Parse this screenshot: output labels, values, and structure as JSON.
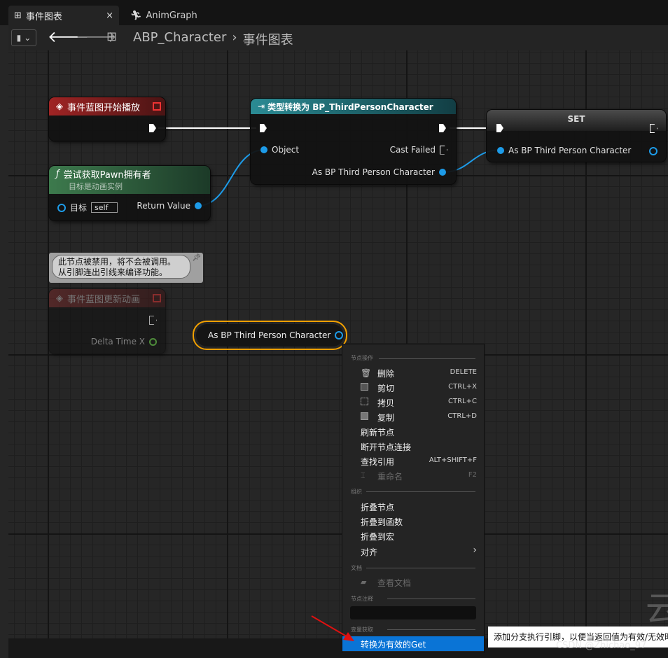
{
  "tabs": [
    {
      "label": "事件图表",
      "icon": "event-graph-icon",
      "active": true,
      "close": "×"
    },
    {
      "label": "AnimGraph",
      "icon": "anim-graph-icon",
      "active": false
    }
  ],
  "breadcrumb": {
    "blueprint": "ABP_Character",
    "separator": "›",
    "graph": "事件图表"
  },
  "nodes": {
    "begin_play": {
      "title": "事件蓝图开始播放"
    },
    "try_get_pawn": {
      "title": "尝试获取Pawn拥有者",
      "subtitle": "目标是动画实例",
      "target_label": "目标",
      "target_value": "self",
      "return_label": "Return Value",
      "function_glyph": "ƒ"
    },
    "cast": {
      "title": "类型转换为 BP_ThirdPersonCharacter",
      "object_label": "Object",
      "cast_failed_label": "Cast Failed",
      "output_label": "As BP Third Person Character"
    },
    "set": {
      "title": "SET",
      "input_label": "As BP Third Person Character"
    },
    "disabled_comment": {
      "line1": "此节点被禁用，将不会被调用。",
      "line2": "从引脚连出引线来编译功能。"
    },
    "update_anim": {
      "title": "事件蓝图更新动画",
      "delta_label": "Delta Time X"
    },
    "get_var": {
      "label": "As BP Third Person Character"
    }
  },
  "context_menu": {
    "sections": {
      "node_actions": "节点操作",
      "organize": "组织",
      "docs": "文档",
      "node_comment": "节点注释",
      "variable_get": "变量获取"
    },
    "node_actions": [
      {
        "label": "删除",
        "shortcut": "DELETE",
        "icon": "trash-icon"
      },
      {
        "label": "剪切",
        "shortcut": "CTRL+X",
        "icon": "cut-icon"
      },
      {
        "label": "拷贝",
        "shortcut": "CTRL+C",
        "icon": "copy-icon"
      },
      {
        "label": "复制",
        "shortcut": "CTRL+D",
        "icon": "duplicate-icon"
      },
      {
        "label": "刷新节点",
        "shortcut": ""
      },
      {
        "label": "断开节点连接",
        "shortcut": ""
      },
      {
        "label": "查找引用",
        "shortcut": "ALT+SHIFT+F"
      },
      {
        "label": "重命名",
        "shortcut": "F2",
        "icon": "rename-icon",
        "disabled": true
      }
    ],
    "organize": [
      {
        "label": "折叠节点"
      },
      {
        "label": "折叠到函数"
      },
      {
        "label": "折叠到宏"
      },
      {
        "label": "对齐",
        "submenu": "›"
      }
    ],
    "docs_item": "查看文档",
    "variable_item": "转换为有效的Get"
  },
  "tooltip": "添加分支执行引脚，以便当返回值为有效/无效时",
  "watermark": "CSDN @Zhichao_97",
  "watermark_big": "云",
  "colors": {
    "accent": "#0a74d6",
    "exec_wire": "#ffffff",
    "object_pin": "#1d9be8",
    "event_header": "#8b1e1e",
    "pure_header": "#2d5c3a",
    "cast_header": "#1e5f66"
  }
}
